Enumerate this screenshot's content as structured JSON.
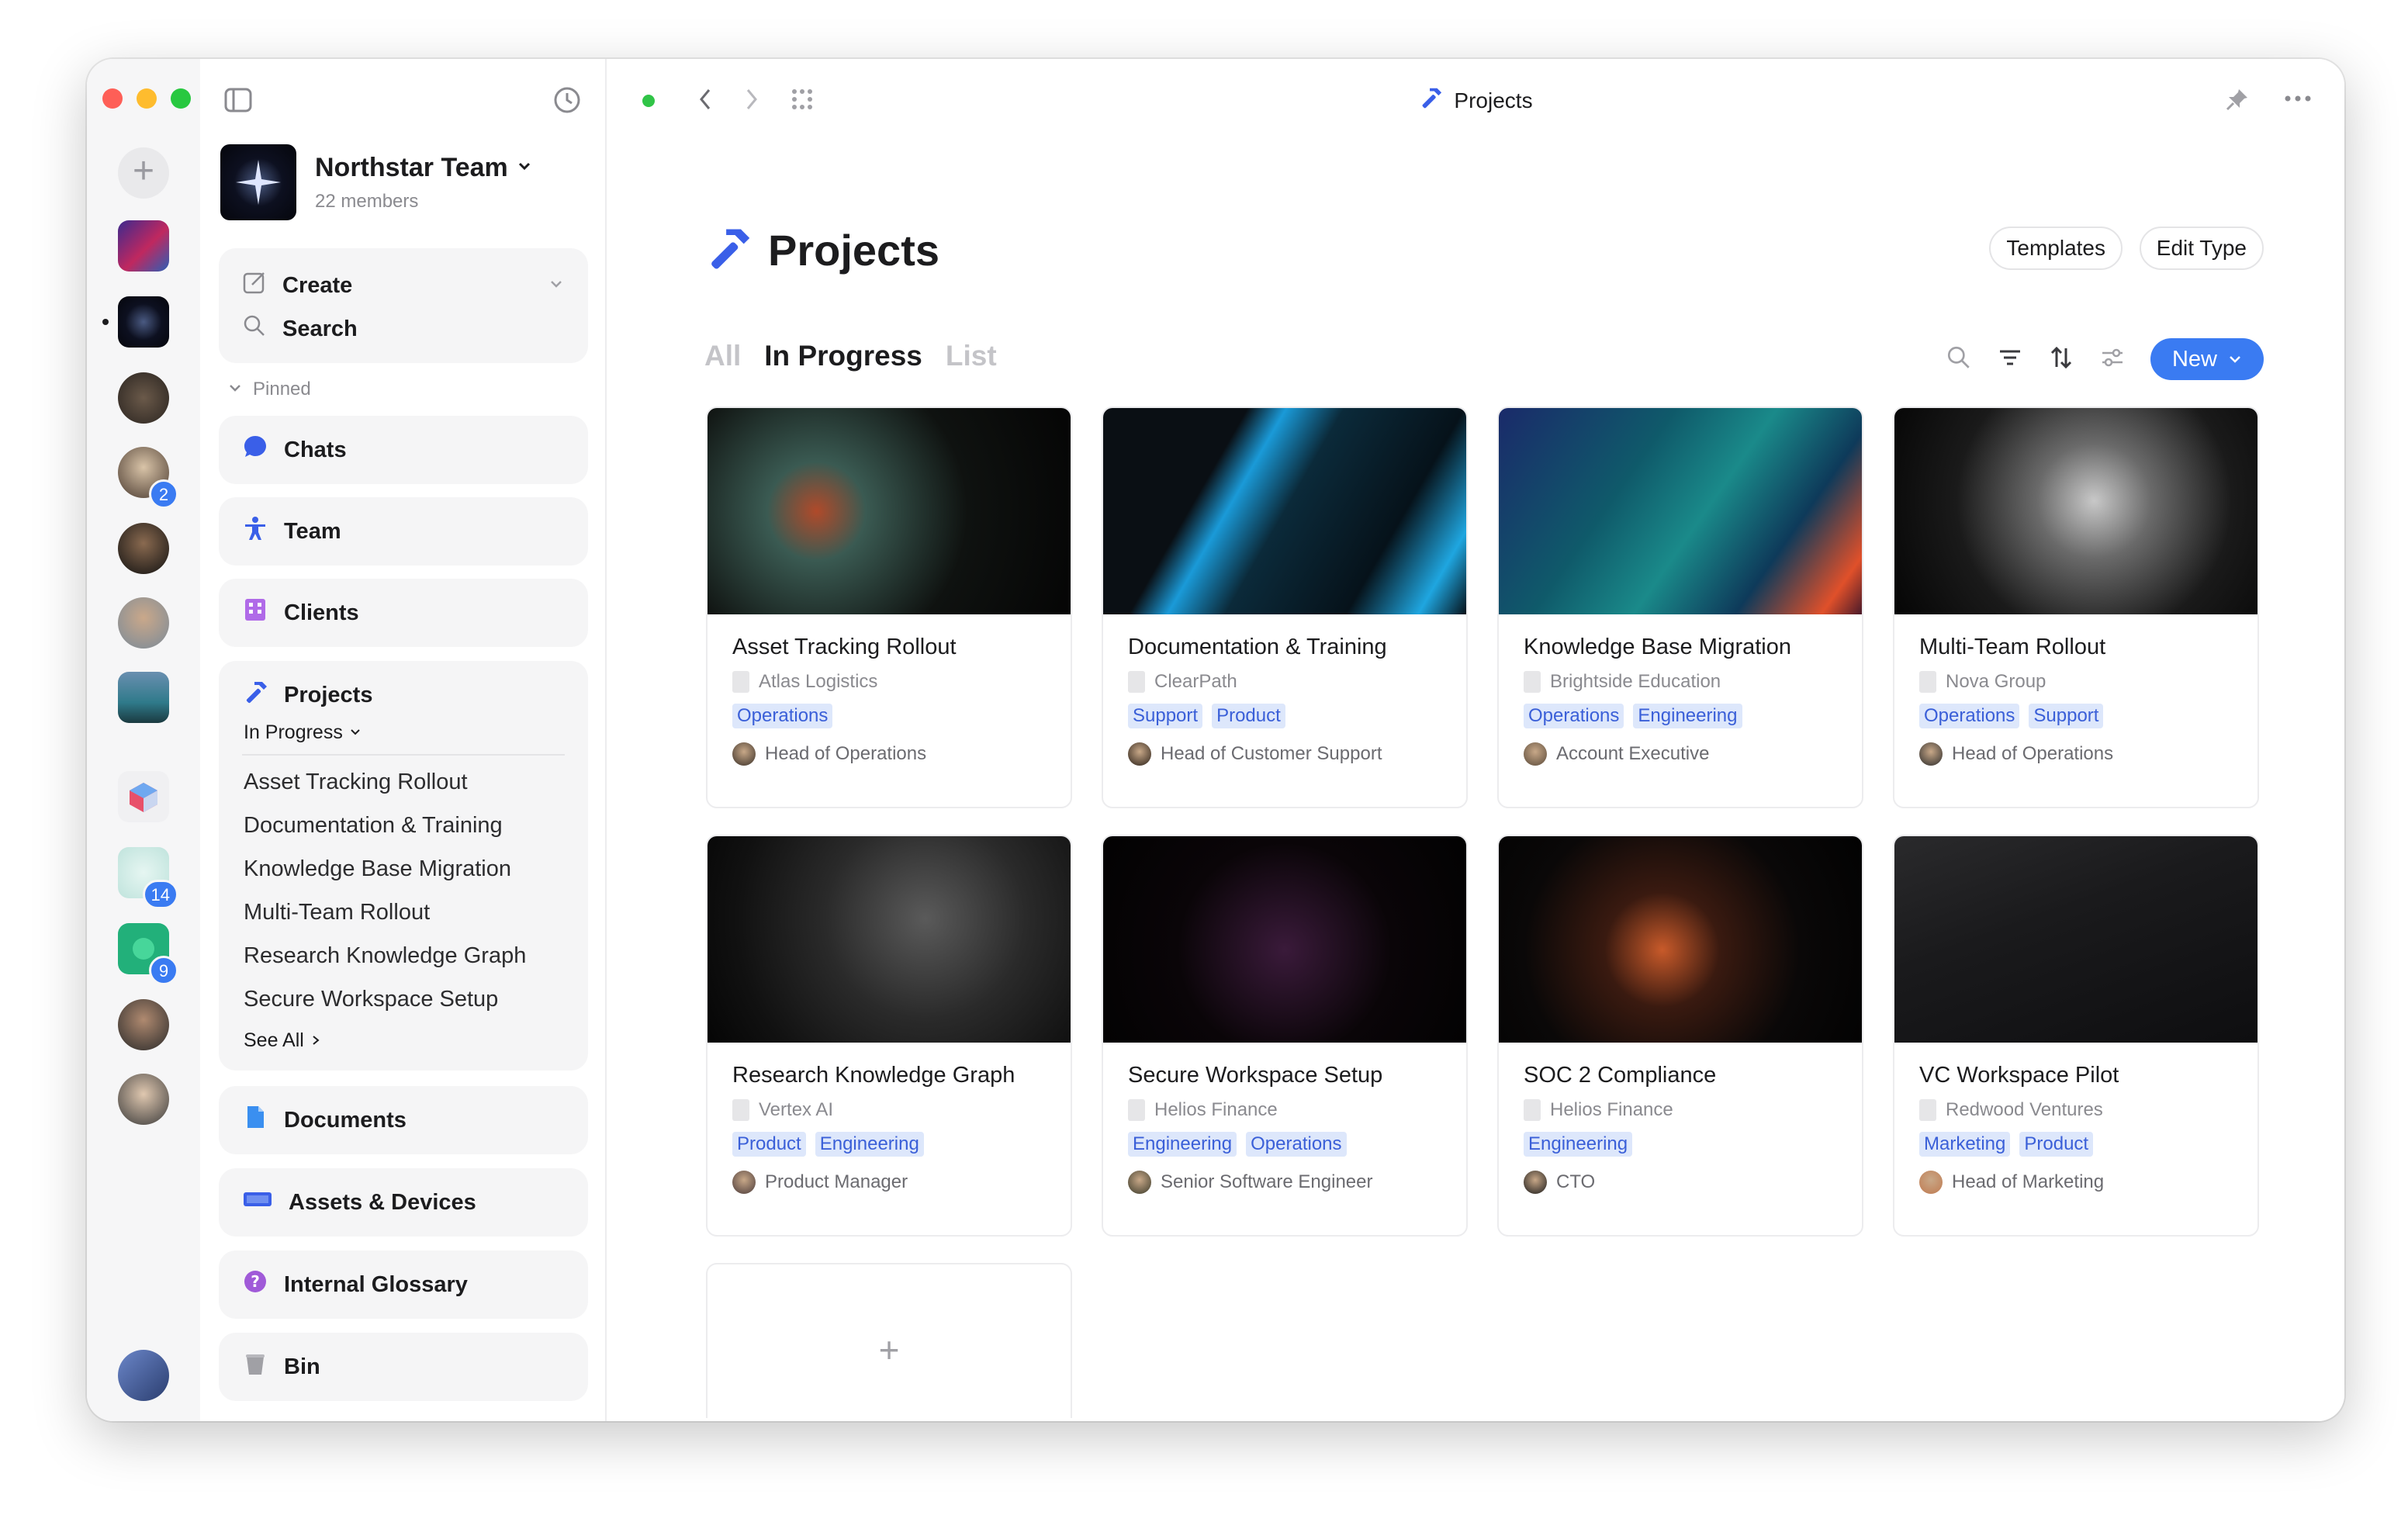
{
  "window": {
    "title": "Projects"
  },
  "rail": {
    "badges": [
      "2",
      "14",
      "9"
    ]
  },
  "sidebar": {
    "team_name": "Northstar Team",
    "team_members": "22 members",
    "create_label": "Create",
    "search_label": "Search",
    "pinned_label": "Pinned",
    "chats_label": "Chats",
    "team_label": "Team",
    "clients_label": "Clients",
    "projects_label": "Projects",
    "projects_filter": "In Progress",
    "projects_items": [
      "Asset Tracking Rollout",
      "Documentation & Training",
      "Knowledge Base Migration",
      "Multi-Team Rollout",
      "Research Knowledge Graph",
      "Secure Workspace Setup"
    ],
    "see_all_label": "See All",
    "documents_label": "Documents",
    "assets_label": "Assets & Devices",
    "glossary_label": "Internal Glossary",
    "bin_label": "Bin"
  },
  "main": {
    "title": "Projects",
    "templates_label": "Templates",
    "edit_type_label": "Edit Type",
    "tabs": [
      "All",
      "In Progress",
      "List"
    ],
    "new_label": "New",
    "add_symbol": "+",
    "projects": [
      {
        "name": "Asset Tracking Rollout",
        "client": "Atlas Logistics",
        "tags": [
          "Operations"
        ],
        "owner": "Head of Operations"
      },
      {
        "name": "Documentation & Training",
        "client": "ClearPath",
        "tags": [
          "Support",
          "Product"
        ],
        "owner": "Head of Customer Support"
      },
      {
        "name": "Knowledge Base Migration",
        "client": "Brightside Education",
        "tags": [
          "Operations",
          "Engineering"
        ],
        "owner": "Account Executive"
      },
      {
        "name": "Multi-Team Rollout",
        "client": "Nova Group",
        "tags": [
          "Operations",
          "Support"
        ],
        "owner": "Head of Operations"
      },
      {
        "name": "Research Knowledge Graph",
        "client": "Vertex AI",
        "tags": [
          "Product",
          "Engineering"
        ],
        "owner": "Product Manager"
      },
      {
        "name": "Secure Workspace Setup",
        "client": "Helios Finance",
        "tags": [
          "Engineering",
          "Operations"
        ],
        "owner": "Senior Software Engineer"
      },
      {
        "name": "SOC 2 Compliance",
        "client": "Helios Finance",
        "tags": [
          "Engineering"
        ],
        "owner": "CTO"
      },
      {
        "name": "VC Workspace Pilot",
        "client": "Redwood Ventures",
        "tags": [
          "Marketing",
          "Product"
        ],
        "owner": "Head of Marketing"
      }
    ]
  },
  "colors": {
    "accent": "#3a7bf2",
    "tag_text": "#3a5fd8",
    "tag_bg": "#dde7fb"
  }
}
